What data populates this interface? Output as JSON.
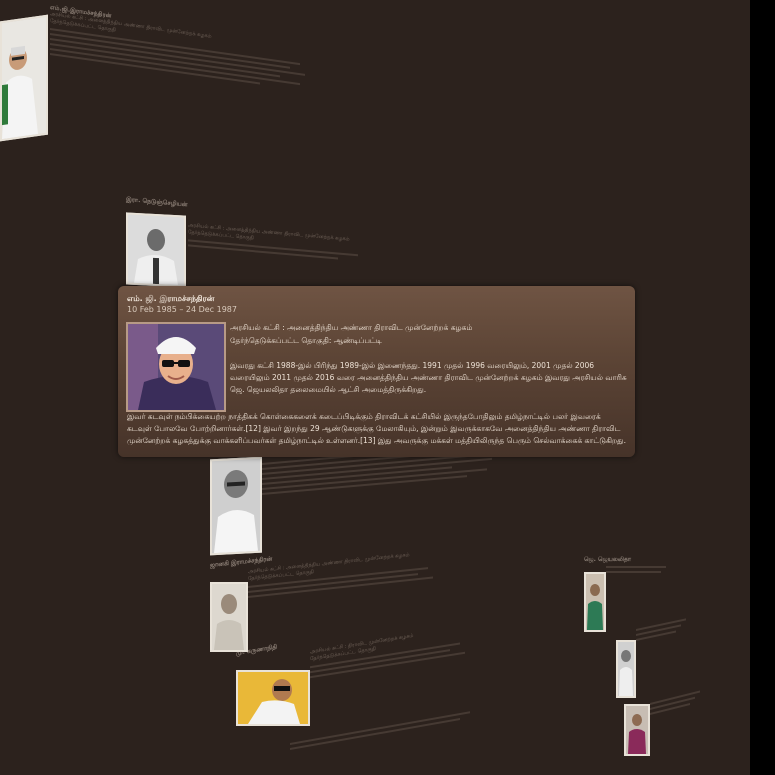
{
  "popup": {
    "name": "எம். ஜி. இராமச்சந்திரன்",
    "dates": "10 Feb 1985 – 24 Dec 1987",
    "party_line": "அரசியல் கட்சி : அனைத்திந்திய அண்ணா திராவிட முன்னேற்றக் கழகம்",
    "constituency_line": "தேர்ந்தெடுக்கப்பட்ட தொகுதி: ஆண்டிப்பட்டி",
    "paragraph1": "இவரது கட்சி 1988-இல் பிரிந்து 1989-இல் இணைந்தது. 1991 முதல் 1996 வரையிலும், 2001 முதல் 2006 வரையிலும் 2011 முதல் 2016 வரை அனைத்திந்திய அண்ணா திராவிட முன்னேற்றக் கழகம் இவரது அரசியல் வாரிசு ஜெ. ஜெயலலிதா தலைமையில் ஆட்சி அமைத்திருக்கிறது.",
    "paragraph2": "இவர் கடவுள் நம்பிக்கையற்ற நாத்திகக் கொள்கைகளைக் கடைப்பிடிக்கும் திராவிடக் கட்சியில் இருந்தபோதிலும் தமிழ்நாட்டில் பலர் இவரைக் கடவுள் போலவே போற்றினார்கள்.[12] இவர் இறந்து 29 ஆண்டுகளுக்கு மேலாகியும், இன்றும் இவருக்காகவே அனைத்திந்திய அண்ணா திராவிட முன்னேற்றக் கழகத்துக்கு வாக்களிப்பவர்கள் தமிழ்நாட்டில் உள்ளனர்.[13] இது அவருக்கு மக்கள் மத்தியிலிருந்த பெரும் செல்வாக்கைக் காட்டுகிறது."
  },
  "background_cards": [
    {
      "title": "எம்.ஜி.இராமச்சந்திரன்",
      "line1": "அரசியல் கட்சி : அனைத்திந்திய அண்ணா திராவிட முன்னேற்றக் கழகம்",
      "line2": "தேர்ந்தெடுக்கப்பட்ட தொகுதி"
    },
    {
      "title": "இரா. நெடுஞ்செழியன்",
      "line1": "அரசியல் கட்சி : அனைத்திந்திய அண்ணா திராவிட முன்னேற்றக் கழகம்",
      "line2": "தேர்ந்தெடுக்கப்பட்ட தொகுதி"
    },
    {
      "title": "ஜானகி இராமச்சந்திரன்",
      "line1": "அரசியல் கட்சி : அனைத்திந்திய அண்ணா திராவிட முன்னேற்றக் கழகம்",
      "line2": "தேர்ந்தெடுக்கப்பட்ட தொகுதி"
    },
    {
      "title": "மு. கருணாநிதி",
      "line1": "அரசியல் கட்சி : திராவிட முன்னேற்றக் கழகம்",
      "line2": "தேர்ந்தெடுக்கப்பட்ட தொகுதி"
    },
    {
      "title": "ஜெ. ஜெயலலிதா",
      "line1": "அரசியல் கட்சி : அனைத்திந்திய அண்ணா திராவிட முன்னேற்றக் கழகம்",
      "line2": "தேர்ந்தெடுக்கப்பட்ட தொகுதி"
    }
  ],
  "colors": {
    "background": "#2c221d",
    "card": "#5d4536",
    "text": "#eee2d6"
  }
}
